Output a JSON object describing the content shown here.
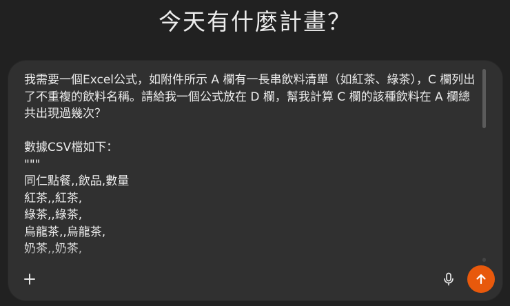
{
  "heading": "今天有什麼計畫？",
  "composer": {
    "text": "我需要一個Excel公式，如附件所示 A 欄有一長串飲料清單（如紅茶、綠茶），C 欄列出了不重複的飲料名稱。請給我一個公式放在 D 欄，幫我計算 C 欄的該種飲料在 A 欄總共出現過幾次？\n\n數據CSV檔如下：\n\"\"\"\n同仁點餐,,飲品,數量\n紅茶,,紅茶,\n綠茶,,綠茶,\n烏龍茶,,烏龍茶,\n奶茶,,奶茶,",
    "add_icon": "plus-icon",
    "mic_icon": "microphone-icon",
    "send_icon": "arrow-up-icon",
    "send_color": "#e8590c"
  }
}
